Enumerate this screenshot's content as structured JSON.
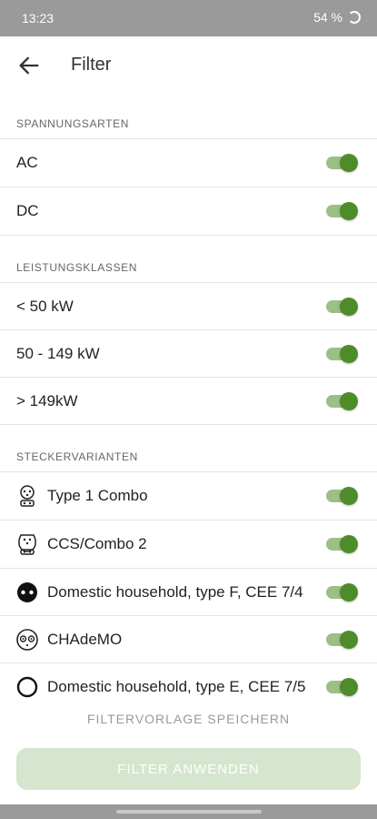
{
  "status_bar": {
    "time": "13:23",
    "battery": "54 %"
  },
  "app_bar": {
    "title": "Filter"
  },
  "sections": {
    "voltage": {
      "header": "SPANNUNGSARTEN",
      "items": [
        {
          "label": "AC",
          "on": true
        },
        {
          "label": "DC",
          "on": true
        }
      ]
    },
    "power": {
      "header": "LEISTUNGSKLASSEN",
      "items": [
        {
          "label": "< 50 kW",
          "on": true
        },
        {
          "label": "50 - 149 kW",
          "on": true
        },
        {
          "label": "> 149kW",
          "on": true
        }
      ]
    },
    "plugs": {
      "header": "STECKERVARIANTEN",
      "items": [
        {
          "label": "Type 1 Combo",
          "icon": "type1-combo-icon",
          "on": true
        },
        {
          "label": "CCS/Combo 2",
          "icon": "ccs-combo2-icon",
          "on": true
        },
        {
          "label": "Domestic household, type F, CEE 7/4",
          "icon": "schuko-plug-icon",
          "on": true
        },
        {
          "label": "CHAdeMO",
          "icon": "chademo-icon",
          "on": true
        },
        {
          "label": "Domestic household, type E, CEE 7/5",
          "icon": "type-e-plug-icon",
          "on": true
        }
      ]
    }
  },
  "actions": {
    "save_template": "FILTERVORLAGE SPEICHERN",
    "apply": "FILTER ANWENDEN"
  },
  "colors": {
    "accent": "#4e8c2a",
    "track": "#9bbf87",
    "apply_disabled_bg": "#d6e5cd"
  }
}
